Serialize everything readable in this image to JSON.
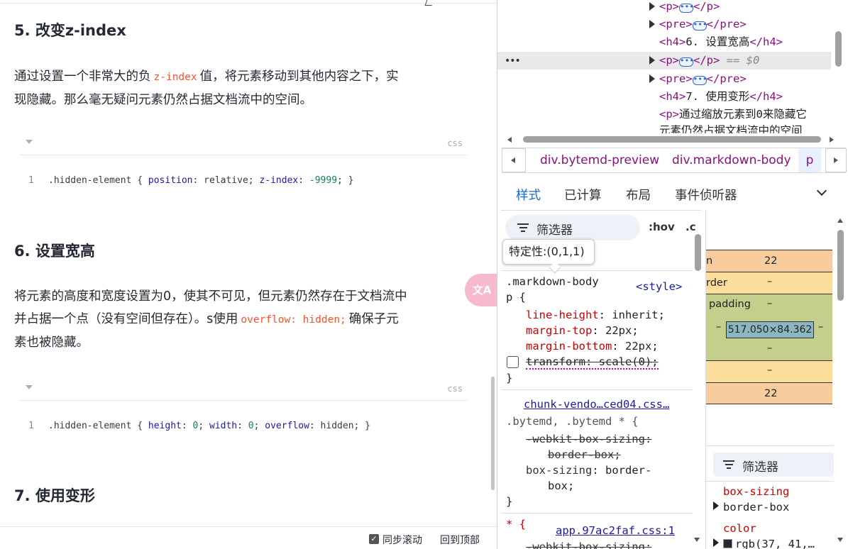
{
  "article": {
    "h5": "5. 改变z-index",
    "p5a": "通过设置一个非常大的负",
    "p5_code": "z-index",
    "p5b": "值，将元素移动到其他内容之下，实",
    "p5c": "现隐藏。那么毫无疑问元素仍然占据文档流中的空间。",
    "code1": {
      "lang": "css",
      "line": "1",
      "sel": ".hidden-element { ",
      "p1": "position",
      "v1": ": relative; ",
      "p2": "z-index",
      "v2a": ": ",
      "v2": "-9999",
      "end": "; }"
    },
    "h6": "6. 设置宽高",
    "p6a": "将元素的高度和宽度设置为0，使其不可见，但元素仍然存在于文档流中",
    "p6b": "并占据一个点（没有空间但存在）。s使用",
    "p6_code": "overflow: hidden;",
    "p6c": "确保子元",
    "p6d": "素也被隐藏。",
    "code2": {
      "lang": "css",
      "line": "1",
      "sel": ".hidden-element { ",
      "p1": "height",
      "v1a": ": ",
      "v1": "0",
      "v1b": "; ",
      "p2": "width",
      "v2a": ": ",
      "v2": "0",
      "v2b": "; ",
      "p3": "overflow",
      "v3": ": hidden; }"
    },
    "h7": "7. 使用变形",
    "sync_label": "同步滚动",
    "totop_label": "回到顶部",
    "translate_label": "文A"
  },
  "dom": {
    "l1": {
      "open": "<p>",
      "close": "</p>"
    },
    "l2": {
      "open": "<pre>",
      "close": "</pre>"
    },
    "l3": {
      "open": "<h4>",
      "text": "6. 设置宽高",
      "close": "</h4>"
    },
    "l4": {
      "open": "<p>",
      "close": "</p>",
      "eq": " == $0"
    },
    "l5": {
      "open": "<pre>",
      "close": "</pre>"
    },
    "l6": {
      "open": "<h4>",
      "text": "7. 使用变形",
      "close": "</h4>"
    },
    "l7": {
      "open": "<p>",
      "text": "通过缩放元素到0来隐藏它"
    },
    "l8": {
      "text": "元素仍然占据文档流中的空间"
    },
    "ellipsis": "•••",
    "dots": "•••"
  },
  "crumbs": {
    "c1": "div.bytemd-preview",
    "c2": "div.markdown-body",
    "c3": "p"
  },
  "tabs": {
    "styles": "样式",
    "computed": "已计算",
    "layout": "布局",
    "listeners": "事件侦听器"
  },
  "styles": {
    "filter_placeholder": "筛选器",
    "hov": ":hov",
    "cls": ".c",
    "tooltip": "特定性:(0,1,1)",
    "r1_sel1": ".markdown-body",
    "r1_sel2": "p {",
    "r1_src": "<style>",
    "r1_p1": "line-height",
    "r1_v1": ": inherit;",
    "r1_p2": "margin-top",
    "r1_v2": ": 22px;",
    "r1_p3": "margin-bottom",
    "r1_v3": ": 22px;",
    "r1_p4": "transform: scale(0);",
    "close": "}",
    "r2_src": "chunk-vendo…ced04.css…",
    "r2_sel": ".bytemd, .bytemd * {",
    "r2_p1": "-webkit-box-sizing:",
    "r2_v1": "border-box;",
    "r2_p2": "box-sizing",
    "r2_v2": ": border-",
    "r2_v2b": "box;",
    "r3_sel": "* {",
    "r3_src": "app.97ac2faf.css:1",
    "r3_p1": "-webkit-box-sizing:"
  },
  "boxmodel": {
    "margin_label": "n",
    "margin_top": "22",
    "border_label": "rder",
    "border_top": "–",
    "padding_label": "padding",
    "padding_top": "–",
    "padding_left": "–",
    "padding_right": "–",
    "content": "517.050×84.362",
    "padding_bottom": "–",
    "border_bottom": "–",
    "margin_bottom": "22"
  },
  "computed": {
    "filter_placeholder": "筛选器",
    "p1_name": "box-sizing",
    "p1_val": "border-box",
    "p2_name": "color",
    "p2_val": "rgb(37, 41,…"
  },
  "colors": {
    "accent": "#1a66cc",
    "tag": "#881280",
    "inline_code": "#ff502c"
  }
}
